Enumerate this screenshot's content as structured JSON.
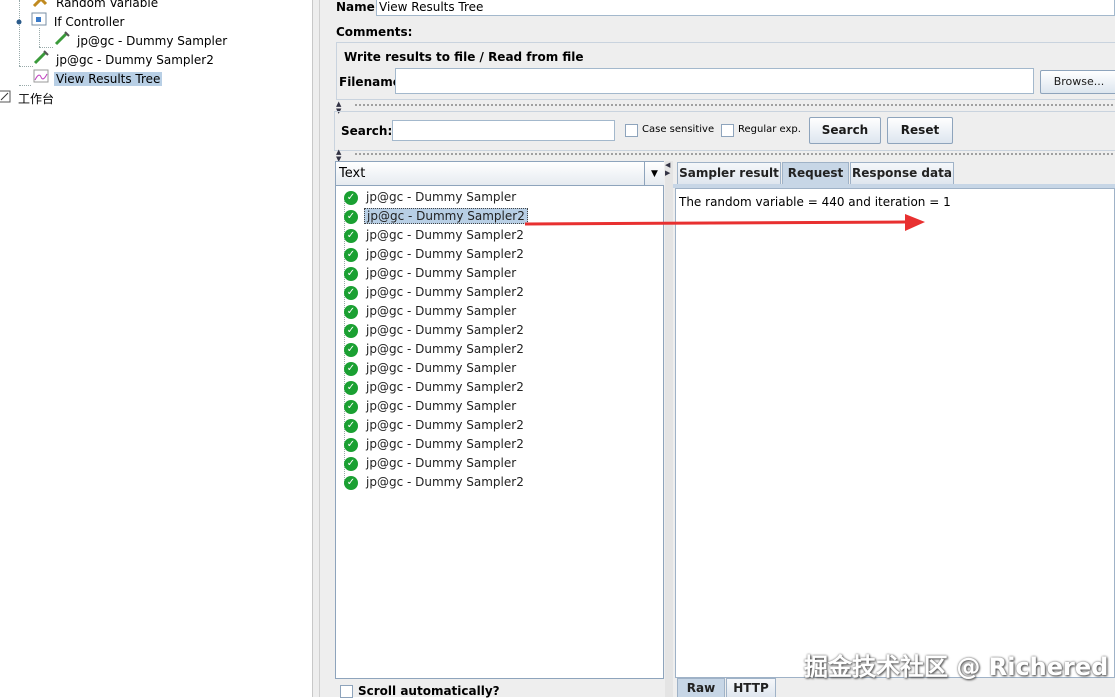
{
  "tree": {
    "items": [
      {
        "label": "Random Variable",
        "icon": "random-variable-icon"
      },
      {
        "label": "If Controller",
        "icon": "if-controller-icon"
      },
      {
        "label": "jp@gc - Dummy Sampler",
        "icon": "sampler-pipette-icon"
      },
      {
        "label": "jp@gc - Dummy Sampler2",
        "icon": "sampler-pipette-icon"
      },
      {
        "label": "View Results Tree",
        "icon": "results-tree-icon"
      },
      {
        "label": "工作台",
        "icon": "workbench-icon"
      }
    ]
  },
  "form": {
    "name_label": "Name:",
    "name_value": "View Results Tree",
    "comments_label": "Comments:",
    "file_section_title": "Write results to file / Read from file",
    "filename_label": "Filename",
    "filename_value": "",
    "browse_label": "Browse..."
  },
  "search": {
    "label": "Search:",
    "value": "",
    "case_sensitive_label": "Case sensitive",
    "regular_exp_label": "Regular exp.",
    "search_button": "Search",
    "reset_button": "Reset"
  },
  "results": {
    "column_header": "Text",
    "items": [
      "jp@gc - Dummy Sampler",
      "jp@gc - Dummy Sampler2",
      "jp@gc - Dummy Sampler2",
      "jp@gc - Dummy Sampler2",
      "jp@gc - Dummy Sampler",
      "jp@gc - Dummy Sampler2",
      "jp@gc - Dummy Sampler",
      "jp@gc - Dummy Sampler2",
      "jp@gc - Dummy Sampler2",
      "jp@gc - Dummy Sampler",
      "jp@gc - Dummy Sampler2",
      "jp@gc - Dummy Sampler",
      "jp@gc - Dummy Sampler2",
      "jp@gc - Dummy Sampler2",
      "jp@gc - Dummy Sampler",
      "jp@gc - Dummy Sampler2"
    ],
    "selected_index": 1,
    "scroll_auto_label": "Scroll automatically?"
  },
  "detail": {
    "tabs": [
      "Sampler result",
      "Request",
      "Response data"
    ],
    "active_tab": "Request",
    "content": "The random variable = 440 and iteration = 1",
    "bottom_tabs": [
      "Raw",
      "HTTP"
    ]
  },
  "watermark": "掘金技术社区 @ Richered",
  "colors": {
    "selection": "#b8cfe5",
    "success_icon": "#1aa032",
    "arrow": "#e83030"
  }
}
